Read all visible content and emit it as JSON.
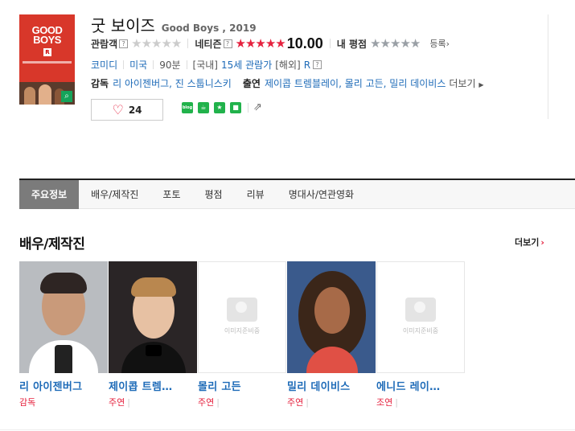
{
  "movie": {
    "title_kr": "굿 보이즈",
    "title_en": "Good Boys , 2019",
    "poster_title": "GOOD BOYS",
    "poster_rating_mark": "R"
  },
  "ratings": {
    "audience_label": "관람객",
    "netizen_label": "네티즌",
    "netizen_score": "10.00",
    "my_rating_label": "내 평점",
    "register_label": "등록",
    "help_mark": "?"
  },
  "meta": {
    "genre": "코미디",
    "country": "미국",
    "runtime": "90분",
    "rating_domestic_prefix": "[국내]",
    "rating_domestic": "15세 관람가",
    "rating_foreign_prefix": "[해외]",
    "rating_foreign": "R"
  },
  "crew": {
    "director_label": "감독",
    "directors": "리 아이젠버그, 진 스툽니스키",
    "cast_label": "출연",
    "cast": "제이콥 트렘블레이, 몰리 고든, 밀리 데이비스",
    "more_label": "더보기"
  },
  "actions": {
    "like_count": "24",
    "blog_label": "blog"
  },
  "tabs": [
    "주요정보",
    "배우/제작진",
    "포토",
    "평점",
    "리뷰",
    "명대사/연관영화"
  ],
  "cast_section": {
    "title": "배우/제작진",
    "more_label": "더보기",
    "no_image_text": "이미지준비중",
    "people": [
      {
        "name": "리 아이젠버그",
        "role": "감독"
      },
      {
        "name": "제이콥 트렘…",
        "role": "주연"
      },
      {
        "name": "몰리 고든",
        "role": "주연"
      },
      {
        "name": "밀리 데이비스",
        "role": "주연"
      },
      {
        "name": "에니드 레이…",
        "role": "조연"
      }
    ]
  }
}
